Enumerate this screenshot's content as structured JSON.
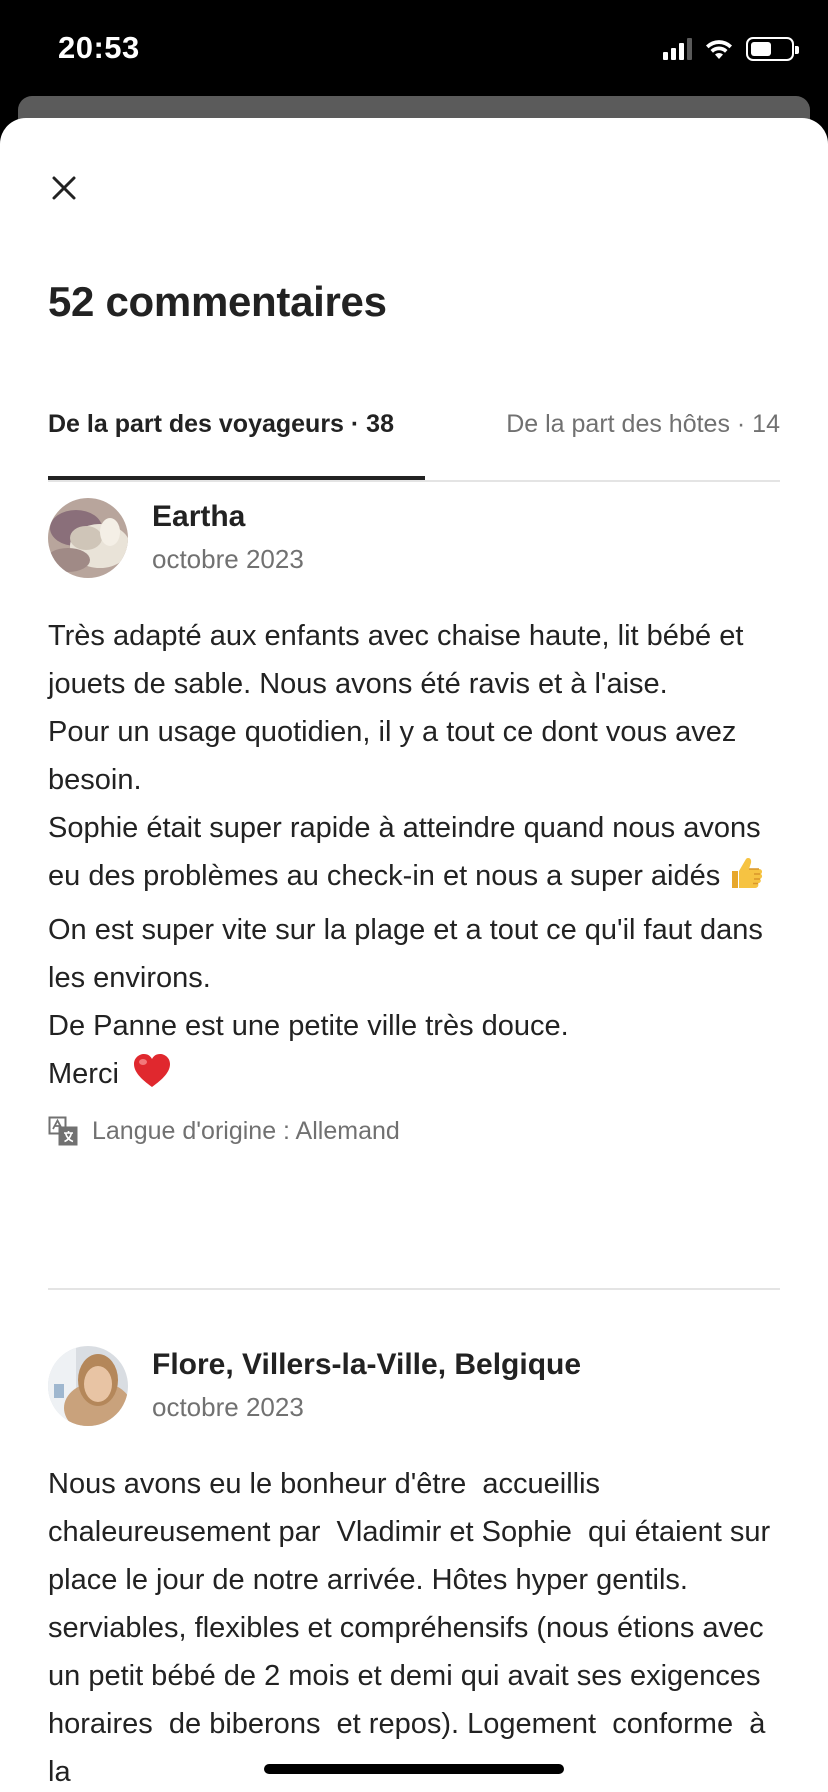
{
  "status_bar": {
    "time": "20:53",
    "icons": [
      "cellular-signal-icon",
      "wifi-icon",
      "battery-icon"
    ]
  },
  "header": {
    "close_icon": "close-icon",
    "title": "52 commentaires"
  },
  "tabs": [
    {
      "label": "De la part des voyageurs · 38",
      "active": true
    },
    {
      "label": "De la part des hôtes · 14",
      "active": false
    }
  ],
  "reviews": [
    {
      "name": "Eartha",
      "date": "octobre 2023",
      "lines": [
        "Très adapté aux enfants avec chaise haute, lit bébé et jouets de sable. Nous avons été ravis et à l'aise.",
        "Pour un usage quotidien, il y a tout ce dont vous avez besoin.",
        "Sophie était super rapide à atteindre quand nous avons eu des problèmes au check-in et nous a super aidés",
        "On est super vite sur la plage et a tout ce qu'il faut dans les environs.",
        "De Panne est une petite ville très douce.",
        "Merci"
      ],
      "emojis": [
        "thumbs-up-emoji",
        "red-heart-emoji"
      ],
      "original_language": "Langue d'origine : Allemand"
    },
    {
      "name": "Flore, Villers-la-Ville, Belgique",
      "date": "octobre 2023",
      "text": "Nous avons eu le bonheur d'être  accueillis chaleureusement par  Vladimir et Sophie  qui étaient sur place le jour de notre arrivée. Hôtes hyper gentils. serviables, flexibles et compréhensifs (nous étions avec un petit bébé de 2 mois et demi qui avait ses exigences horaires  de biberons  et repos). Logement  conforme  à  la"
    }
  ],
  "colors": {
    "text_primary": "#222222",
    "text_secondary": "#717171",
    "divider": "#e4e4e4",
    "heart": "#e0282e"
  }
}
